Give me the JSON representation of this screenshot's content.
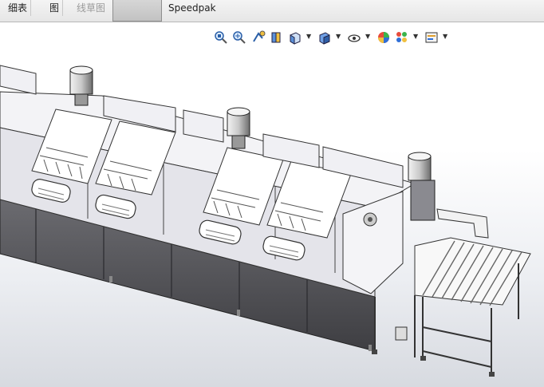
{
  "tabs": [
    {
      "label": "细表",
      "dim": false
    },
    {
      "label": "图",
      "dim": false
    },
    {
      "label": "线草图",
      "dim": true
    },
    {
      "label": "",
      "dim": false
    },
    {
      "label": "Speedpak",
      "dim": false
    }
  ],
  "hud_icons": [
    "zoom-to-fit-icon",
    "zoom-to-area-icon",
    "previous-view-icon",
    "section-view-icon",
    "view-orientation-icon",
    "display-style-icon",
    "hide-show-items-icon",
    "edit-appearance-icon",
    "apply-scene-icon",
    "view-settings-icon"
  ],
  "colors": {
    "accent": "#1f6fd0",
    "machine_body": "#e9e9ee",
    "machine_base": "#5c5c60"
  }
}
